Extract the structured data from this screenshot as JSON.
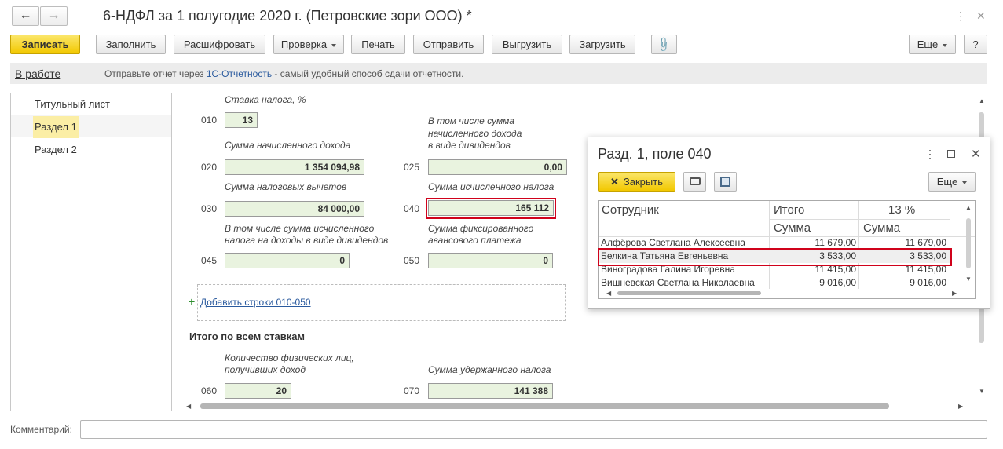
{
  "window": {
    "title": "6-НДФЛ за 1 полугодие 2020 г. (Петровские зори ООО) *",
    "back_icon": "arrow-left-icon",
    "forward_icon": "arrow-right-icon"
  },
  "toolbar": {
    "save": "Записать",
    "fill": "Заполнить",
    "decode": "Расшифровать",
    "check": "Проверка",
    "print": "Печать",
    "send": "Отправить",
    "export": "Выгрузить",
    "import": "Загрузить",
    "more": "Еще",
    "help": "?"
  },
  "status": {
    "state": "В работе",
    "text_before": "Отправьте отчет через ",
    "link": "1С-Отчетность",
    "text_after": " - самый удобный способ сдачи отчетности."
  },
  "nav": {
    "items": [
      "Титульный лист",
      "Раздел 1",
      "Раздел 2"
    ]
  },
  "form": {
    "rate_label": "Ставка налога, %",
    "f010": {
      "code": "010",
      "value": "13"
    },
    "f020": {
      "code": "020",
      "label": "Сумма начисленного дохода",
      "value": "1 354 094,98"
    },
    "f025": {
      "code": "025",
      "label_1": "В том числе сумма",
      "label_2": "начисленного дохода",
      "label_3": "в виде дивидендов",
      "value": "0,00"
    },
    "f030": {
      "code": "030",
      "label": "Сумма налоговых вычетов",
      "value": "84 000,00"
    },
    "f040": {
      "code": "040",
      "label": "Сумма исчисленного налога",
      "value": "165 112"
    },
    "f045": {
      "code": "045",
      "label_1": "В том числе сумма исчисленного",
      "label_2": "налога на доходы в виде дивидендов",
      "value": "0"
    },
    "f050": {
      "code": "050",
      "label_1": "Сумма фиксированного",
      "label_2": "авансового платежа",
      "value": "0"
    },
    "add_rows": "Добавить строки 010-050",
    "totals_title": "Итого по всем ставкам",
    "f060": {
      "code": "060",
      "label_1": "Количество физических лиц,",
      "label_2": "получивших доход",
      "value": "20"
    },
    "f070": {
      "code": "070",
      "label": "Сумма удержанного налога",
      "value": "141 388"
    }
  },
  "popup": {
    "title": "Разд. 1, поле 040",
    "close": "Закрыть",
    "more": "Еще",
    "columns": {
      "employee": "Сотрудник",
      "total": "Итого",
      "rate": "13 %",
      "sum1": "Сумма",
      "sum2": "Сумма"
    },
    "rows": [
      {
        "name": "Алфёрова Светлана Алексеевна",
        "total": "11 679,00",
        "rate13": "11 679,00"
      },
      {
        "name": "Белкина Татьяна Евгеньевна",
        "total": "3 533,00",
        "rate13": "3 533,00"
      },
      {
        "name": "Виноградова Галина Игоревна",
        "total": "11 415,00",
        "rate13": "11 415,00"
      },
      {
        "name": "Вишневская Светлана Николаевна",
        "total": "9 016,00",
        "rate13": "9 016,00"
      }
    ]
  },
  "comment": {
    "label": "Комментарий:",
    "value": ""
  },
  "colors": {
    "accent": "#f2c800",
    "field_bg": "#e9f3df",
    "highlight_red": "#d0021b",
    "link": "#2a5a9e"
  }
}
